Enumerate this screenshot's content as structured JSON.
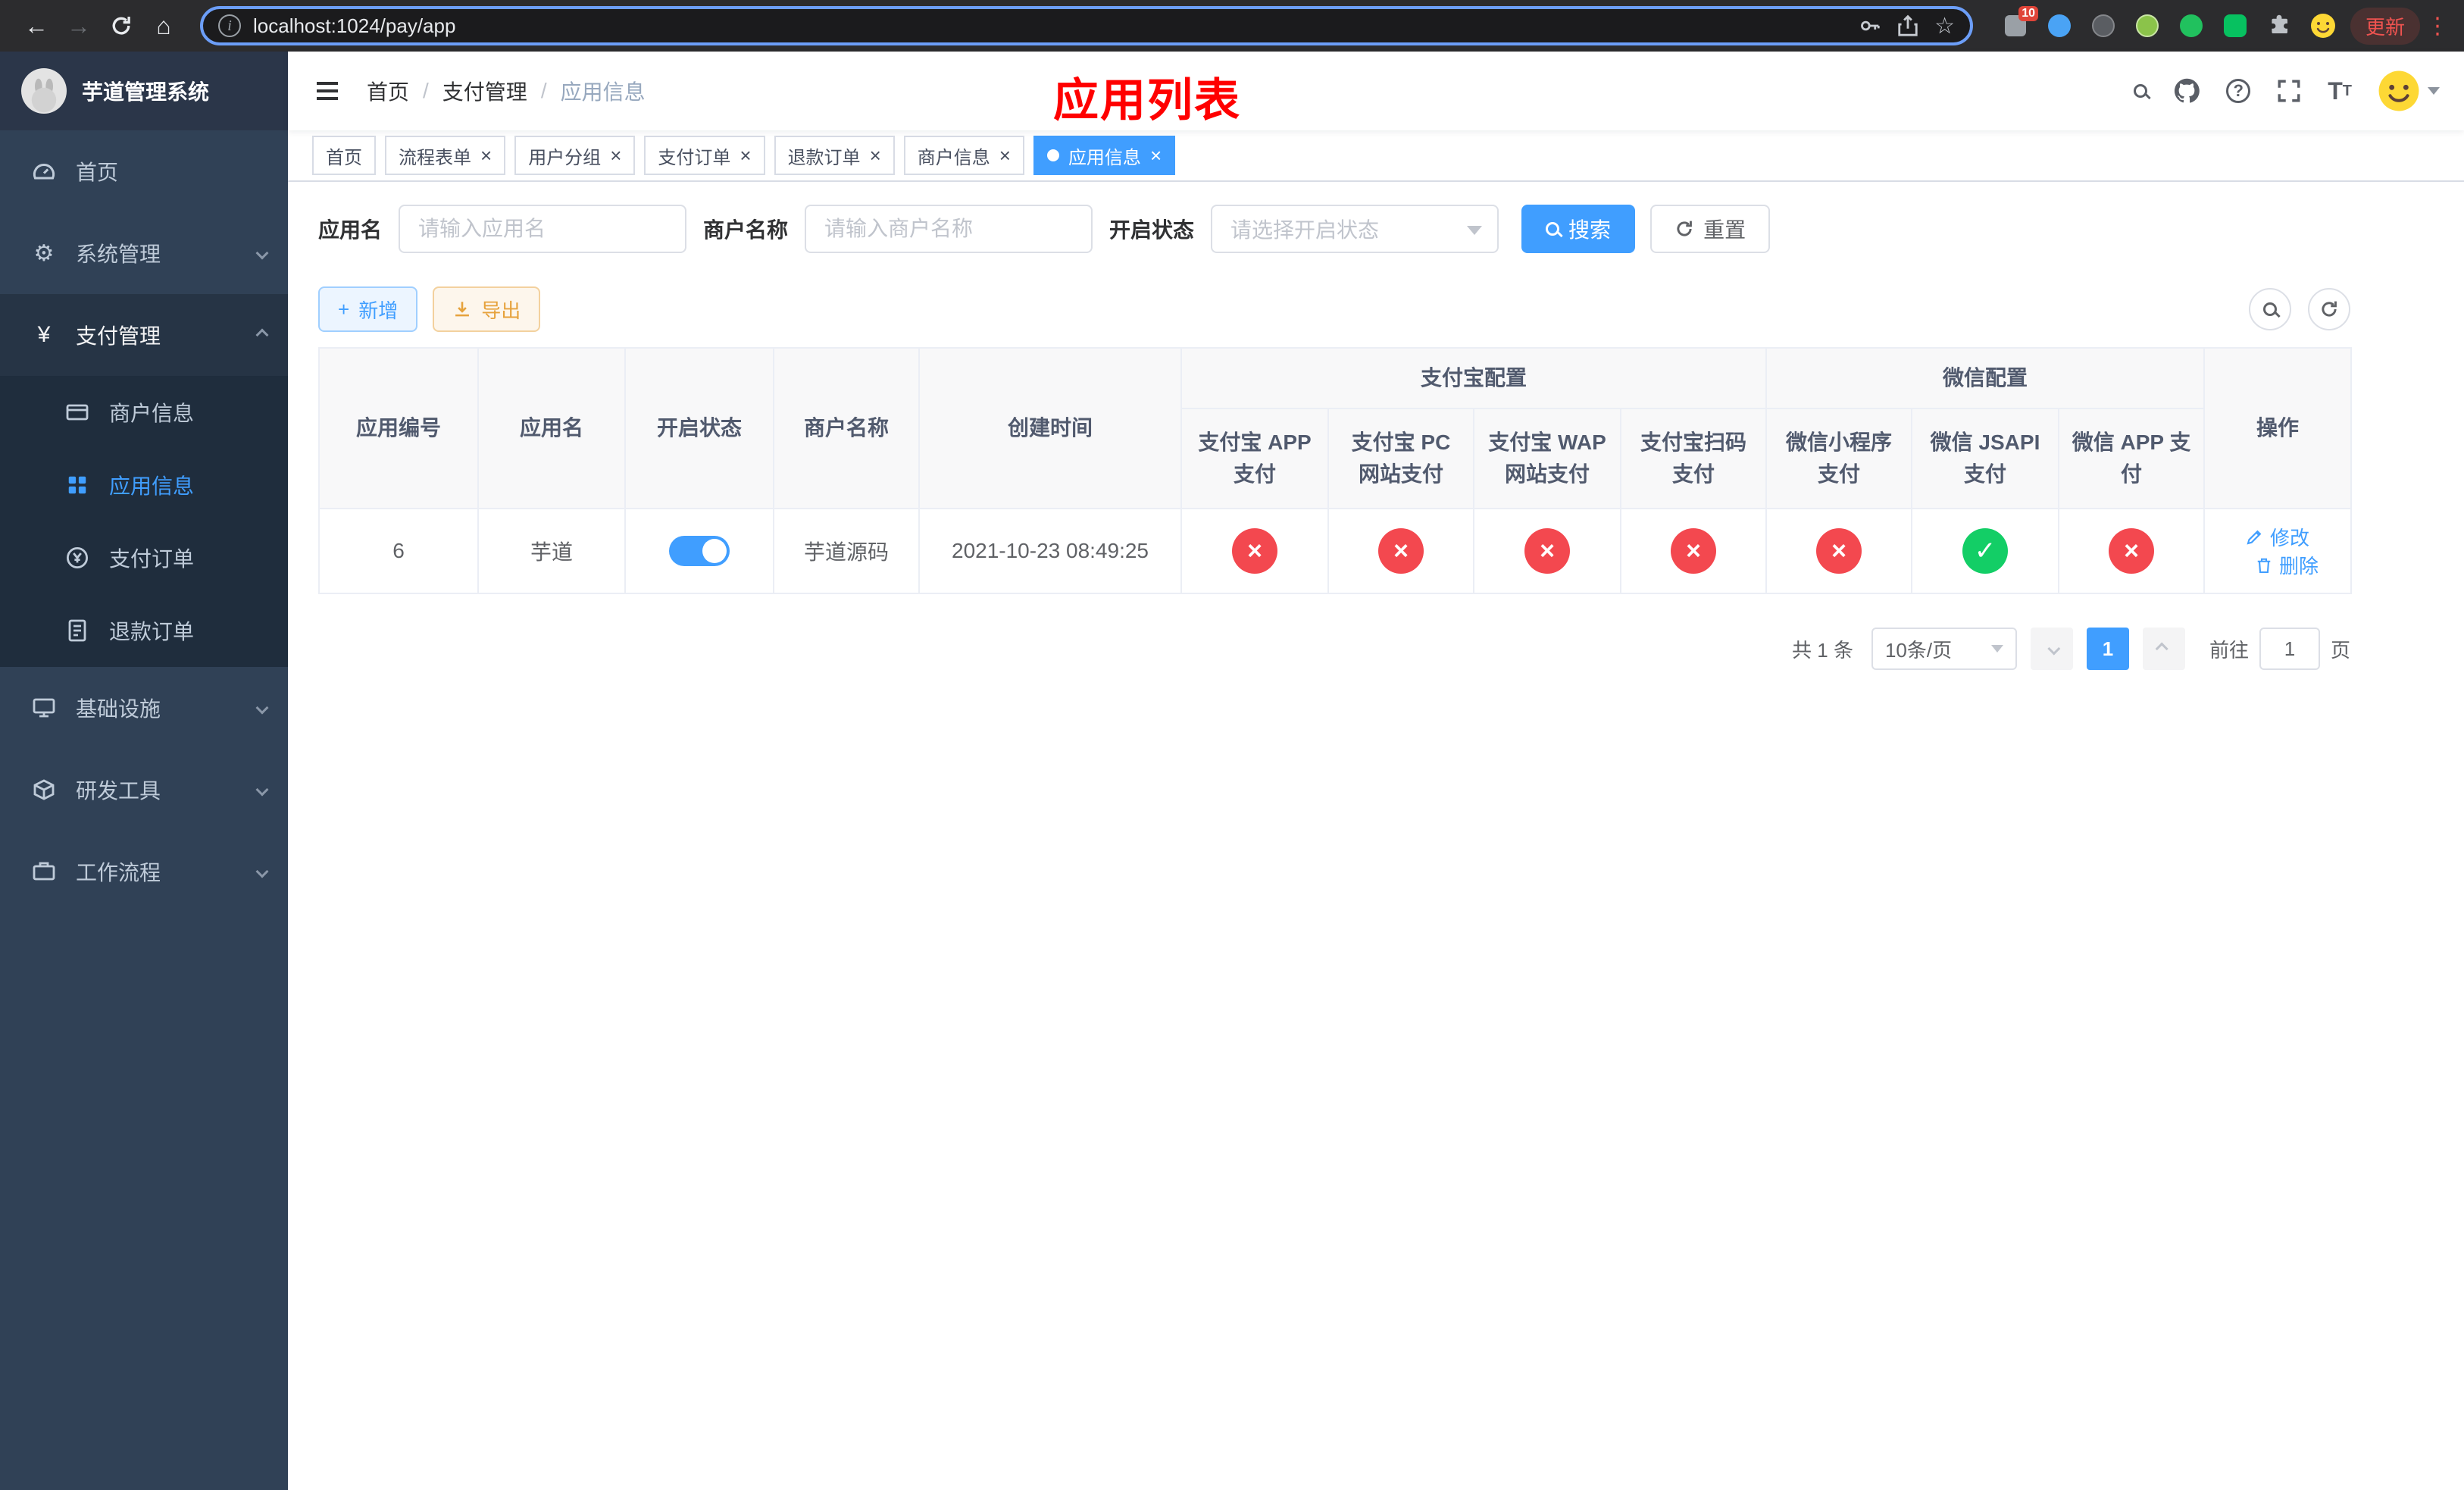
{
  "browser": {
    "url": "localhost:1024/pay/app",
    "update_label": "更新",
    "extension_badge": "10"
  },
  "icons": {
    "back": "←",
    "forward": "→",
    "home": "⌂",
    "star": "☆",
    "menu": "⋮",
    "info": "i",
    "help": "?",
    "gear": "⚙",
    "yen": "¥",
    "letter_big": "T",
    "letter_small": "T"
  },
  "glyphs": {
    "check": "✓",
    "cross": "×",
    "close": "×",
    "plus": "+"
  },
  "sidebar": {
    "title": "芋道管理系统",
    "items": [
      {
        "label": "首页"
      },
      {
        "label": "系统管理"
      },
      {
        "label": "支付管理",
        "children": [
          {
            "label": "商户信息"
          },
          {
            "label": "应用信息"
          },
          {
            "label": "支付订单"
          },
          {
            "label": "退款订单"
          }
        ]
      },
      {
        "label": "基础设施"
      },
      {
        "label": "研发工具"
      },
      {
        "label": "工作流程"
      }
    ]
  },
  "header": {
    "breadcrumb": {
      "items": [
        "首页",
        "支付管理",
        "应用信息"
      ],
      "separator": "/"
    },
    "annotation": "应用列表"
  },
  "tabs": [
    {
      "label": "首页"
    },
    {
      "label": "流程表单"
    },
    {
      "label": "用户分组"
    },
    {
      "label": "支付订单"
    },
    {
      "label": "退款订单"
    },
    {
      "label": "商户信息"
    },
    {
      "label": "应用信息"
    }
  ],
  "filters": {
    "app_name_label": "应用名",
    "app_name_placeholder": "请输入应用名",
    "merchant_label": "商户名称",
    "merchant_placeholder": "请输入商户名称",
    "status_label": "开启状态",
    "status_placeholder": "请选择开启状态",
    "search_label": "搜索",
    "reset_label": "重置"
  },
  "toolbar": {
    "add_label": "新增",
    "export_label": "导出"
  },
  "table": {
    "group_alipay": "支付宝配置",
    "group_wechat": "微信配置",
    "columns": {
      "id": "应用编号",
      "name": "应用名",
      "status": "开启状态",
      "merchant": "商户名称",
      "created": "创建时间",
      "alipay_app": "支付宝 APP 支付",
      "alipay_pc": "支付宝 PC 网站支付",
      "alipay_wap": "支付宝 WAP 网站支付",
      "alipay_qr": "支付宝扫码支付",
      "wx_mini": "微信小程序支付",
      "wx_jsapi": "微信 JSAPI 支付",
      "wx_app": "微信 APP 支付",
      "actions": "操作"
    },
    "rows": [
      {
        "id": "6",
        "name": "芋道",
        "enabled": true,
        "merchant": "芋道源码",
        "created": "2021-10-23 08:49:25",
        "alipay_app": false,
        "alipay_pc": false,
        "alipay_wap": false,
        "alipay_qr": false,
        "wx_mini": false,
        "wx_jsapi": true,
        "wx_app": false,
        "edit_label": "修改",
        "delete_label": "删除"
      }
    ]
  },
  "pagination": {
    "total": "共 1 条",
    "page_size": "10条/页",
    "page": "1",
    "goto_label": "前往",
    "goto_value": "1",
    "unit_label": "页"
  },
  "colors": {
    "primary": "#409eff",
    "danger": "#f3484f",
    "success": "#13ce66",
    "sidebar_bg": "#304156",
    "submenu_bg": "#1f2d3d",
    "annotation": "#ff0000"
  }
}
